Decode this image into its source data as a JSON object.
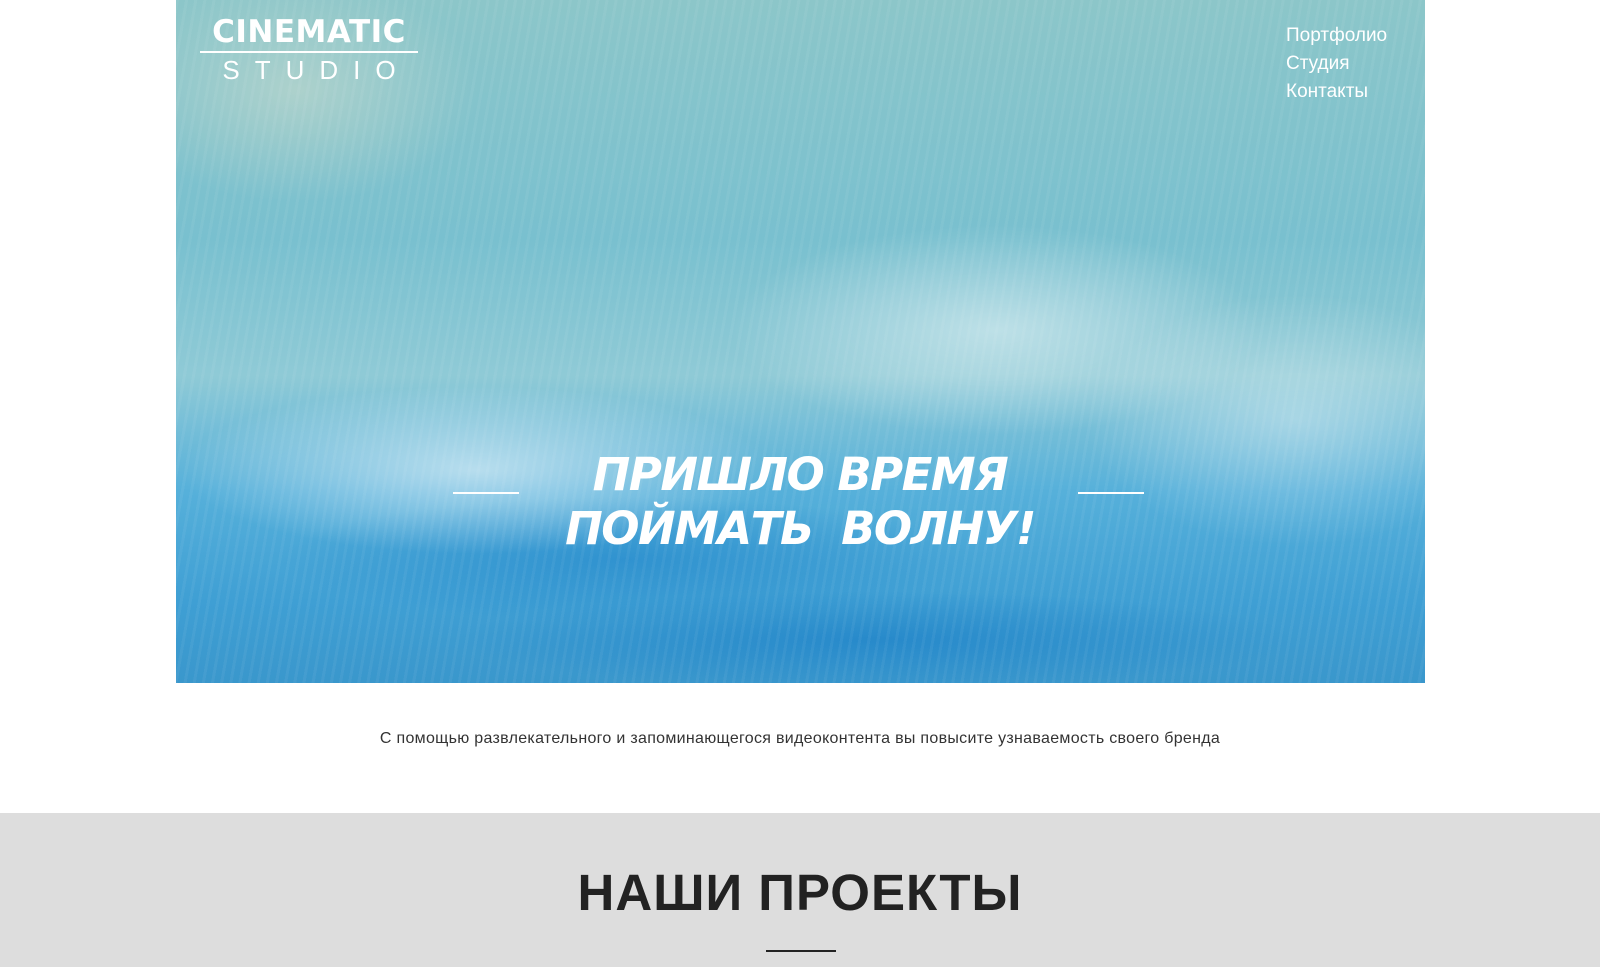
{
  "header": {
    "logo": {
      "line1": "CINEMATIC",
      "line2": "STUDIO"
    },
    "nav": [
      {
        "label": "Портфолио"
      },
      {
        "label": "Студия"
      },
      {
        "label": "Контакты"
      }
    ]
  },
  "hero": {
    "headline_line1": "ПРИШЛО ВРЕМЯ",
    "headline_line2": "ПОЙМАТЬ  ВОЛНУ!"
  },
  "intro": {
    "text": "С помощью развлекательного и запоминающегося видеоконтента вы повысите узнаваемость своего бренда"
  },
  "projects": {
    "title": "НАШИ ПРОЕКТЫ"
  },
  "colors": {
    "text_dark": "#222222",
    "projects_bg": "#dddddd",
    "hero_blue": "#3f9fd4"
  }
}
